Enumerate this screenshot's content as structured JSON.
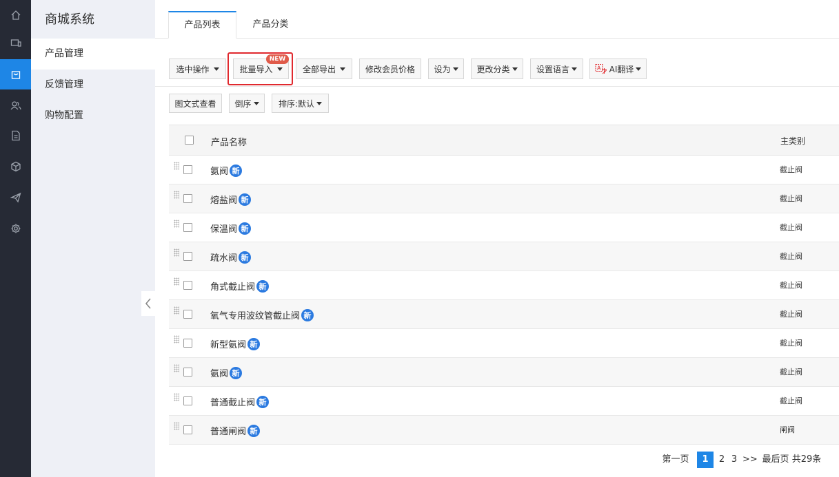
{
  "rail": {
    "items": [
      {
        "icon": "home-icon"
      },
      {
        "icon": "monitor-icon"
      },
      {
        "icon": "shop-bag-icon",
        "active": true
      },
      {
        "icon": "users-icon"
      },
      {
        "icon": "document-icon"
      },
      {
        "icon": "cube-icon"
      },
      {
        "icon": "send-icon"
      },
      {
        "icon": "gear-icon"
      }
    ]
  },
  "sidebar": {
    "title": "商城系统",
    "items": [
      {
        "label": "产品管理",
        "active": true
      },
      {
        "label": "反馈管理"
      },
      {
        "label": "购物配置"
      }
    ]
  },
  "tabs": [
    {
      "label": "产品列表",
      "active": true
    },
    {
      "label": "产品分类"
    }
  ],
  "toolbar": {
    "select_ops": "选中操作",
    "batch_import": "批量导入",
    "new_badge": "NEW",
    "export_all": "全部导出",
    "member_price": "修改会员价格",
    "set_as": "设为",
    "change_category": "更改分类",
    "set_language": "设置语言",
    "ai_translate": "AI翻译"
  },
  "view_bar": {
    "graphic_view": "图文式查看",
    "reverse": "倒序",
    "sort": "排序:默认"
  },
  "table": {
    "headers": {
      "name": "产品名称",
      "category": "主类别"
    },
    "new_tag": "新",
    "rows": [
      {
        "name": "氨阀",
        "category": "截止阀"
      },
      {
        "name": "熔盐阀",
        "category": "截止阀"
      },
      {
        "name": "保温阀",
        "category": "截止阀"
      },
      {
        "name": "疏水阀",
        "category": "截止阀"
      },
      {
        "name": "角式截止阀",
        "category": "截止阀"
      },
      {
        "name": "氧气专用波纹管截止阀",
        "category": "截止阀"
      },
      {
        "name": "新型氨阀",
        "category": "截止阀"
      },
      {
        "name": "氨阀",
        "category": "截止阀"
      },
      {
        "name": "普通截止阀",
        "category": "截止阀"
      },
      {
        "name": "普通闸阀",
        "category": "闸阀"
      }
    ]
  },
  "pagination": {
    "first": "第一页",
    "pages": [
      "1",
      "2",
      "3"
    ],
    "current": "1",
    "next": ">>",
    "last": "最后页",
    "total": "共29条"
  },
  "colors": {
    "accent": "#1e86e6",
    "rail_bg": "#262a35",
    "sidebar_bg": "#eef0f6",
    "highlight": "#e0292e",
    "new_badge": "#e05b4a",
    "new_tag": "#2b7ae0"
  }
}
